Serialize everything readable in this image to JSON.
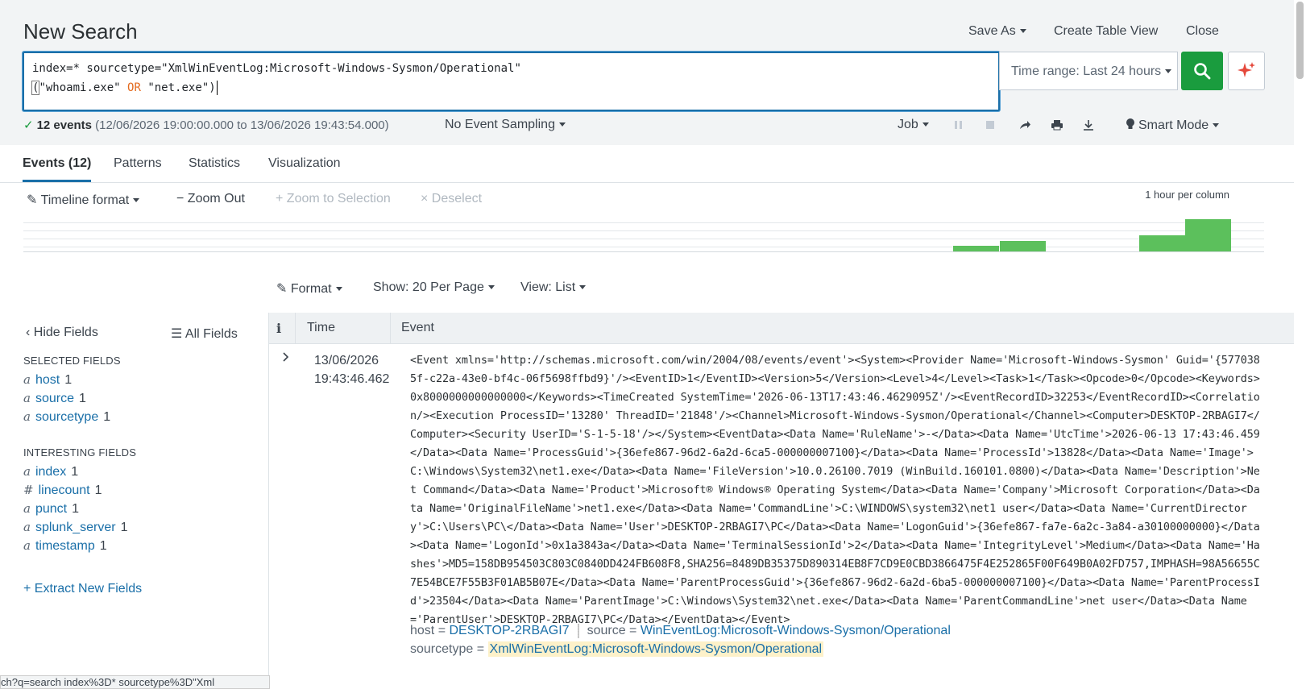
{
  "header": {
    "title": "New Search",
    "save_as": "Save As",
    "create_table_view": "Create Table View",
    "close": "Close"
  },
  "search": {
    "line1": "index=* sourcetype=\"XmlWinEventLog:Microsoft-Windows-Sysmon/Operational\"",
    "line2_open": "(",
    "line2_a": "\"whoami.exe\"",
    "line2_op": "OR",
    "line2_b": "\"net.exe\"",
    "line2_close": ")",
    "time_range": "Time range: Last 24 hours"
  },
  "status": {
    "events": "12 events",
    "range": "(12/06/2026 19:00:00.000 to 13/06/2026 19:43:54.000)",
    "sampling": "No Event Sampling",
    "job": "Job",
    "mode": "Smart Mode"
  },
  "tabs": [
    "Events (12)",
    "Patterns",
    "Statistics",
    "Visualization"
  ],
  "timeline": {
    "format": "Timeline format",
    "zoom_out": "Zoom Out",
    "zoom_selection": "Zoom to Selection",
    "deselect": "Deselect",
    "per_column": "1 hour per column",
    "bars": [
      0,
      0,
      0,
      0,
      0,
      0,
      0,
      0,
      0,
      0,
      0,
      0,
      0,
      0,
      0,
      0,
      0,
      0,
      0,
      0,
      1,
      2,
      0,
      0,
      3,
      6
    ]
  },
  "list_controls": {
    "format": "Format",
    "show": "Show: 20 Per Page",
    "view": "View: List"
  },
  "sidebar": {
    "hide_fields": "Hide Fields",
    "all_fields": "All Fields",
    "selected_title": "SELECTED FIELDS",
    "selected": [
      {
        "type": "a",
        "name": "host",
        "count": "1"
      },
      {
        "type": "a",
        "name": "source",
        "count": "1"
      },
      {
        "type": "a",
        "name": "sourcetype",
        "count": "1"
      }
    ],
    "interesting_title": "INTERESTING FIELDS",
    "interesting": [
      {
        "type": "a",
        "name": "index",
        "count": "1"
      },
      {
        "type": "#",
        "name": "linecount",
        "count": "1"
      },
      {
        "type": "a",
        "name": "punct",
        "count": "1"
      },
      {
        "type": "a",
        "name": "splunk_server",
        "count": "1"
      },
      {
        "type": "a",
        "name": "timestamp",
        "count": "1"
      }
    ],
    "extract": "+ Extract New Fields"
  },
  "table": {
    "col_i": "i",
    "col_time": "Time",
    "col_event": "Event"
  },
  "event": {
    "date": "13/06/2026",
    "time": "19:43:46.462",
    "text": "<Event xmlns='http://schemas.microsoft.com/win/2004/08/events/event'><System><Provider Name='Microsoft-Windows-Sysmon' Guid='{5770385f-c22a-43e0-bf4c-06f5698ffbd9}'/><EventID>1</EventID><Version>5</Version><Level>4</Level><Task>1</Task><Opcode>0</Opcode><Keywords>0x8000000000000000</Keywords><TimeCreated SystemTime='2026-06-13T17:43:46.4629095Z'/><EventRecordID>32253</EventRecordID><Correlation/><Execution ProcessID='13280' ThreadID='21848'/><Channel>Microsoft-Windows-Sysmon/Operational</Channel><Computer>DESKTOP-2RBAGI7</Computer><Security UserID='S-1-5-18'/></System><EventData><Data Name='RuleName'>-</Data><Data Name='UtcTime'>2026-06-13 17:43:46.459</Data><Data Name='ProcessGuid'>{36efe867-96d2-6a2d-6ca5-000000007100}</Data><Data Name='ProcessId'>13828</Data><Data Name='Image'>C:\\Windows\\System32\\net1.exe</Data><Data Name='FileVersion'>10.0.26100.7019 (WinBuild.160101.0800)</Data><Data Name='Description'>Net Command</Data><Data Name='Product'>Microsoft® Windows® Operating System</Data><Data Name='Company'>Microsoft Corporation</Data><Data Name='OriginalFileName'>net1.exe</Data><Data Name='CommandLine'>C:\\WINDOWS\\system32\\net1  user</Data><Data Name='CurrentDirectory'>C:\\Users\\PC\\</Data><Data Name='User'>DESKTOP-2RBAGI7\\PC</Data><Data Name='LogonGuid'>{36efe867-fa7e-6a2c-3a84-a30100000000}</Data><Data Name='LogonId'>0x1a3843a</Data><Data Name='TerminalSessionId'>2</Data><Data Name='IntegrityLevel'>Medium</Data><Data Name='Hashes'>MD5=158DB954503C803C0840DD424FB608F8,SHA256=8489DB35375D890314EB8F7CD9E0CBD3866475F4E252865F00F649B0A02FD757,IMPHASH=98A56655C7E54BCE7F55B3F01AB5B07E</Data><Data Name='ParentProcessGuid'>{36efe867-96d2-6a2d-6ba5-000000007100}</Data><Data Name='ParentProcessId'>23504</Data><Data Name='ParentImage'>C:\\Windows\\System32\\net.exe</Data><Data Name='ParentCommandLine'>net  user</Data><Data Name='ParentUser'>DESKTOP-2RBAGI7\\PC</Data></EventData></Event>",
    "host_label": "host =",
    "host_value": "DESKTOP-2RBAGI7",
    "source_label": "source =",
    "source_value": "WinEventLog:Microsoft-Windows-Sysmon/Operational",
    "sourcetype_label": "sourcetype =",
    "sourcetype_value": "XmlWinEventLog:Microsoft-Windows-Sysmon/Operational"
  },
  "browser_status": {
    "url": "ch?q=search index%3D* sourcetype%3D\"Xml"
  },
  "colors": {
    "accent": "#1a6fa8",
    "go_button": "#1a9c3e",
    "timeline_bar": "#5cc05c",
    "keyword_op": "#e36a1e"
  }
}
